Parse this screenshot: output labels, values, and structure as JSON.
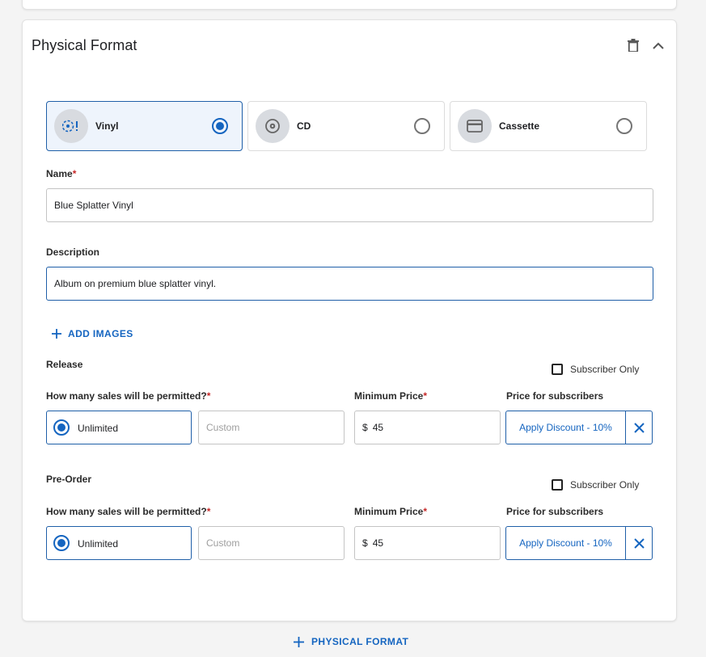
{
  "section": {
    "title": "Physical Format"
  },
  "formats": [
    {
      "label": "Vinyl",
      "selected": true
    },
    {
      "label": "CD",
      "selected": false
    },
    {
      "label": "Cassette",
      "selected": false
    }
  ],
  "name_field": {
    "label": "Name",
    "required_mark": "*",
    "value": "Blue Splatter Vinyl"
  },
  "description_field": {
    "label": "Description",
    "value": "Album on premium blue splatter vinyl."
  },
  "add_images_label": "ADD IMAGES",
  "release": {
    "heading": "Release",
    "subscriber_only_label": "Subscriber Only",
    "sales_label": "How many sales will be permitted?",
    "required_mark": "*",
    "unlimited_label": "Unlimited",
    "custom_placeholder": "Custom",
    "min_price_label": "Minimum Price",
    "currency": "$",
    "min_price_value": "45",
    "subscriber_price_label": "Price for subscribers",
    "discount_label": "Apply Discount - 10%"
  },
  "preorder": {
    "heading": "Pre-Order",
    "subscriber_only_label": "Subscriber Only",
    "sales_label": "How many sales will be permitted?",
    "required_mark": "*",
    "unlimited_label": "Unlimited",
    "custom_placeholder": "Custom",
    "min_price_label": "Minimum Price",
    "currency": "$",
    "min_price_value": "45",
    "subscriber_price_label": "Price for subscribers",
    "discount_label": "Apply Discount - 10%"
  },
  "add_format_label": "PHYSICAL FORMAT",
  "colors": {
    "accent": "#1565c0",
    "border_selected": "#1f5fa8",
    "required": "#c62828"
  }
}
